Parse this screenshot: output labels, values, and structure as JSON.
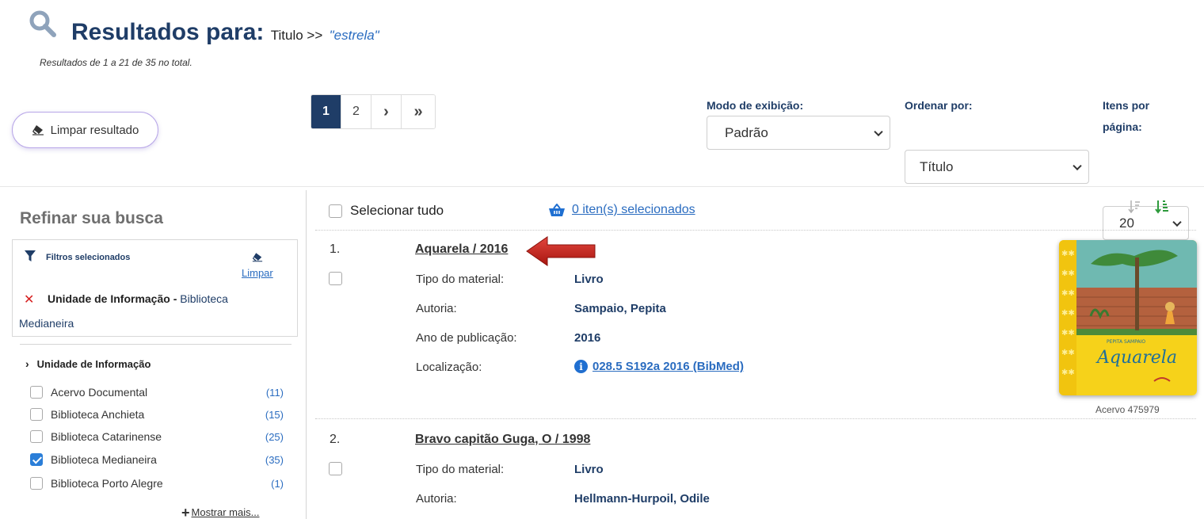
{
  "header": {
    "title": "Resultados para:",
    "field": "Titulo >>",
    "term": "\"estrela\"",
    "results_count": "Resultados de 1 a 21 de 35 no total."
  },
  "toolbar": {
    "clear_label": "Limpar resultado"
  },
  "pagination": [
    "1",
    "2",
    "›",
    "»"
  ],
  "display_mode": {
    "label": "Modo de exibição:",
    "value": "Padrão"
  },
  "sort_by": {
    "label": "Ordenar por:",
    "value": "Título"
  },
  "per_page": {
    "label_line1": "Itens por",
    "label_line2": "página:",
    "value": "20"
  },
  "sidebar": {
    "refine_title": "Refinar sua busca",
    "selected_filters_title": "Filtros selecionados",
    "clear_filters": "Limpar",
    "active_filter": {
      "field": "Unidade de Informação",
      "separator": " - ",
      "value_part1": "Biblioteca",
      "value_part2": "Medianeira"
    },
    "facet_title": "Unidade de Informação",
    "facet_items": [
      {
        "label": "Acervo Documental",
        "count": "(11)",
        "checked": false
      },
      {
        "label": "Biblioteca Anchieta",
        "count": "(15)",
        "checked": false
      },
      {
        "label": "Biblioteca Catarinense",
        "count": "(25)",
        "checked": false
      },
      {
        "label": "Biblioteca Medianeira",
        "count": "(35)",
        "checked": true
      },
      {
        "label": "Biblioteca Porto Alegre",
        "count": "(1)",
        "checked": false
      }
    ],
    "show_more": "Mostrar mais..."
  },
  "results_header": {
    "select_all": "Selecionar tudo",
    "selected_items": "0 iten(s) selecionados"
  },
  "results": [
    {
      "number": "1.",
      "title": "Aquarela / 2016",
      "fields": [
        {
          "label": "Tipo do material:",
          "value": "Livro"
        },
        {
          "label": "Autoria:",
          "value": "Sampaio, Pepita"
        },
        {
          "label": "Ano de publicação:",
          "value": "2016"
        },
        {
          "label": "Localização:",
          "value": "028.5 S192a 2016 (BibMed)"
        }
      ],
      "cover_author": "PEPITA SAMPAIO",
      "cover_title": "Aquarela",
      "acervo": "Acervo 475979"
    },
    {
      "number": "2.",
      "title": "Bravo capitão Guga, O / 1998",
      "fields": [
        {
          "label": "Tipo do material:",
          "value": "Livro"
        },
        {
          "label": "Autoria:",
          "value": "Hellmann-Hurpoil, Odile"
        }
      ]
    }
  ],
  "colors": {
    "navy": "#1f3d67",
    "link_blue": "#2a6cc0",
    "remove_red": "#d62020",
    "arrow_red": "#c0201c"
  }
}
